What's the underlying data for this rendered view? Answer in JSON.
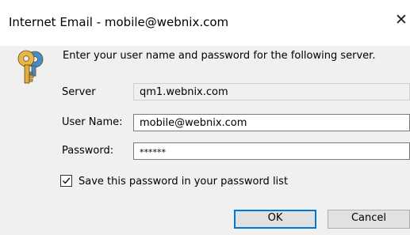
{
  "window": {
    "title": "Internet Email - mobile@webnix.com",
    "close_glyph": "✕"
  },
  "prompt": "Enter your user name and password for the following server.",
  "icon": "keys-icon",
  "fields": {
    "server": {
      "label": "Server",
      "value": "qm1.webnix.com"
    },
    "username": {
      "label": "User Name:",
      "value": "mobile@webnix.com"
    },
    "password": {
      "label": "Password:",
      "value": "******"
    }
  },
  "save_password": {
    "label": "Save this password in your password list",
    "checked": true
  },
  "buttons": {
    "ok": "OK",
    "cancel": "Cancel"
  },
  "colors": {
    "accent": "#0078d7",
    "background": "#f0f0f0"
  }
}
